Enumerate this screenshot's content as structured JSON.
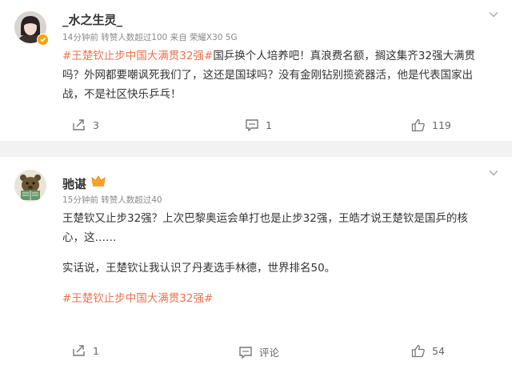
{
  "post1": {
    "username": "_水之生灵_",
    "meta": "14分钟前 转赞人数超过100 来自 荣耀X30 5G",
    "hashtag": "#王楚钦止步中国大满贯32强#",
    "text_line1": "国乒换个人培养吧！真浪费名额，搁这集齐32强大满贯",
    "text_line2": "吗？外网都要嘲讽死我们了，这还是国球吗？没有金刚钻别揽瓷器活，他是代表国家出",
    "text_line3": "战，不是社区快乐乒乓！",
    "repost_count": "3",
    "comment_count": "1",
    "like_count": "119"
  },
  "post2": {
    "username": "驰谌",
    "meta": "15分钟前 转赞人数超过40",
    "text_line1": "王楚钦又止步32强？上次巴黎奥运会单打也是止步32强，王皓才说王楚钦是国乒的核",
    "text_line2": "心，这……",
    "text_line3": "实话说，王楚钦让我认识了丹麦选手林德，世界排名50。",
    "hashtag": "#王楚钦止步中国大满贯32强#",
    "repost_count": "1",
    "comment_label": "评论",
    "like_count": "54"
  },
  "colors": {
    "hashtag": "#eb7350",
    "verified_badge": "#f3a20b",
    "divider": "#f2f2f2",
    "meta_text": "#8a8a8a"
  },
  "icons": {
    "menu": "chevron-down-icon",
    "repost": "repost-icon",
    "comment": "comment-icon",
    "like": "thumbs-up-icon",
    "crown": "crown-icon",
    "verified": "verified-badge-icon"
  }
}
